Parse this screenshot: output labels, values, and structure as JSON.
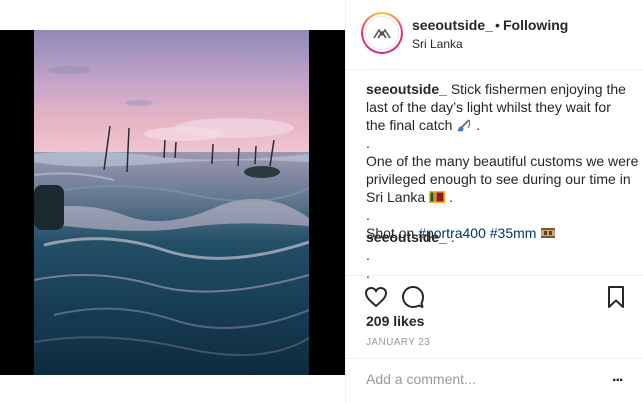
{
  "header": {
    "username": "seeoutside_",
    "separator": "•",
    "follow_state": "Following",
    "location": "Sri Lanka"
  },
  "caption": {
    "username": "seeoutside_",
    "line1": " Stick fishermen enjoying the",
    "line2": "last of the day’s light whilst they wait for",
    "line3": "the final catch",
    "line3_end": ".",
    "dot_a": ".",
    "line4": "One of the many beautiful customs we were",
    "line5": "privileged enough to see during our time in",
    "line6": "Sri Lanka",
    "line6_end": ".",
    "dot_b": ".",
    "shot_prefix": "Shot on ",
    "hashtag1": "#portra400",
    "hashtag2": "#35mm",
    "emoji1": "fishing-pole-emoji",
    "emoji2": "sri-lanka-flag-emoji",
    "emoji3": "film-roll-emoji"
  },
  "comment": {
    "username": "seeoutside_",
    "text": " .",
    "dot1": ".",
    "dot2": "."
  },
  "actions": {
    "like_icon": "heart-icon",
    "comment_icon": "comment-bubble-icon",
    "save_icon": "bookmark-icon"
  },
  "likes": "209 likes",
  "date": "JANUARY 23",
  "add_comment": {
    "placeholder": "Add a comment...",
    "more": "..."
  },
  "colors": {
    "text": "#262626",
    "muted": "#999999",
    "hashtag": "#003569",
    "divider": "#efefef"
  }
}
